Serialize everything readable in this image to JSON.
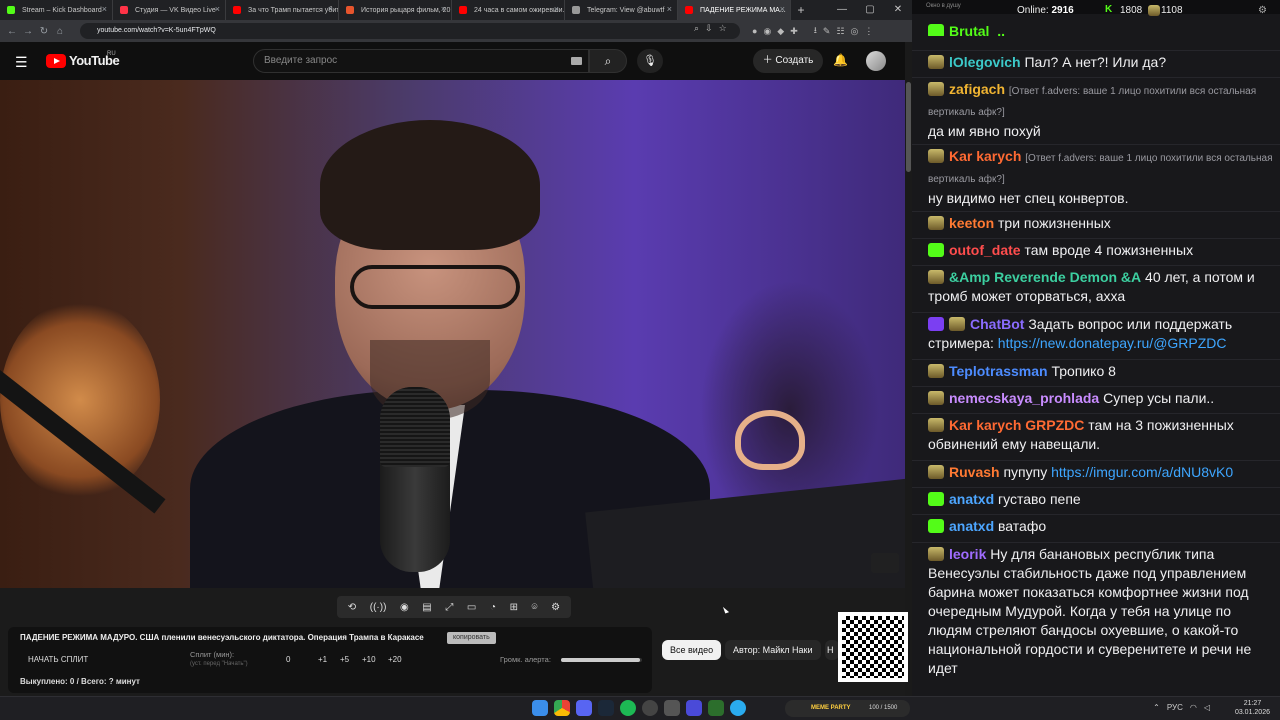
{
  "browser": {
    "tabs": [
      {
        "label": "Stream – Kick Dashboard",
        "color": "#53fc18"
      },
      {
        "label": "Студия — VK Видео Live",
        "color": "#ff3347"
      },
      {
        "label": "За что Трамп пытается убить...",
        "color": "#ff0000"
      },
      {
        "label": "История рыцаря фильм, 20...",
        "color": "#e8552d"
      },
      {
        "label": "24 часа в самом ожиревши...",
        "color": "#ff0000"
      },
      {
        "label": "Telegram: View @abuwtf",
        "color": "#999999"
      },
      {
        "label": "ПАДЕНИЕ РЕЖИМА МА...",
        "color": "#ff0000"
      }
    ],
    "url": "youtube.com/watch?v=K-5un4FTpWQ"
  },
  "youtube": {
    "logo_text": "YouTube",
    "region": "RU",
    "search_placeholder": "Введите запрос",
    "create_label": "Создать"
  },
  "overlay": {
    "title": "ПАДЕНИЕ РЕЖИМА МАДУРО. США пленили венесуэльского диктатора. Операция Трампа в Каракасе",
    "copy_label": "копировать",
    "start_split": "НАЧАТЬ СПЛИТ",
    "split_label": "Сплит (мин):",
    "split_sub": "(уст. перед \"Начать\")",
    "split_value": "0",
    "increments": [
      "+1",
      "+5",
      "+10",
      "+20"
    ],
    "alert_label": "Громк. алерта:",
    "alert_volume": 0.98,
    "bought": "Выкуплено: 0 / Всего: ? минут"
  },
  "chips": {
    "all": "Все видео",
    "author": "Автор: Майкл Наки",
    "more": "Н"
  },
  "chat": {
    "window_title": "Окно в душу",
    "online_label": "Online:",
    "online_value": "2916",
    "kick_count": "1808",
    "other_count": "1108",
    "messages": [
      {
        "badge": "k",
        "user": "Brutal_..",
        "color": "#53fc18",
        "text": ""
      },
      {
        "badge": "g",
        "user": "lOlegovich",
        "color": "#3cc9c9",
        "text": "Пал? А нет?! Или да?"
      },
      {
        "badge": "g",
        "user": "zafigach",
        "color": "#f0b432",
        "reply": "[Ответ f.advers: ваше 1 лицо похитили вся остальная вертикаль афк?]",
        "text": "да им явно похуй"
      },
      {
        "badge": "g",
        "user": "Kar karych",
        "color": "#ff6a33",
        "reply": "[Ответ f.advers: ваше 1 лицо похитили вся остальная вертикаль афк?]",
        "text": "ну видимо нет спец конвертов."
      },
      {
        "badge": "g",
        "user": "keeton",
        "color": "#ff7a33",
        "text": "три пожизненных"
      },
      {
        "badge": "k",
        "user": "outof_date",
        "color": "#ff4d4d",
        "text": "там вроде 4 пожизненных"
      },
      {
        "badge": "g",
        "user": "&Amp Reverende Demon &A",
        "color": "#3ccfa0",
        "text": "40 лет, а потом и тромб может оторваться, ахха"
      },
      {
        "badge": "pg",
        "user": "ChatBot",
        "color": "#8a6cff",
        "text": "Задать вопрос или поддержать стримера:",
        "link": "https://new.donatepay.ru/@GRPZDC"
      },
      {
        "badge": "g",
        "user": "Teplotrassman",
        "color": "#4d8cff",
        "text": "Тропико 8"
      },
      {
        "badge": "g",
        "user": "nemecskaya_prohlada",
        "color": "#c98cff",
        "text": "Супер усы пали.."
      },
      {
        "badge": "g",
        "user": "Kar karych",
        "color": "#ff6a33",
        "mention": "GRPZDC",
        "text": "там на 3 пожизненных обвинений ему навещали."
      },
      {
        "badge": "g",
        "user": "Ruvash",
        "color": "#ff7a33",
        "text": "пупупу",
        "link": "https://imgur.com/a/dNU8vK0"
      },
      {
        "badge": "k",
        "user": "anatxd",
        "color": "#4da6ff",
        "text": "густаво пепе"
      },
      {
        "badge": "k",
        "user": "anatxd",
        "color": "#4da6ff",
        "text": "ватафо"
      },
      {
        "badge": "g",
        "user": "leorik",
        "color": "#a06cff",
        "text": "Ну для банановых республик типа Венесуэлы стабильность даже под управлением барина может показаться комфортнее жизни под очередным Мудурой. Когда у тебя на улице по людям стреляют бандосы охуевшие, о какой-то национальной гордости и суверенитете и речи не идет"
      }
    ]
  },
  "taskbar": {
    "meme_label": "MEME PARTY",
    "meme_progress": "100 / 1500",
    "lang": "РУС",
    "time": "21:27",
    "date": "03.01.2026"
  }
}
